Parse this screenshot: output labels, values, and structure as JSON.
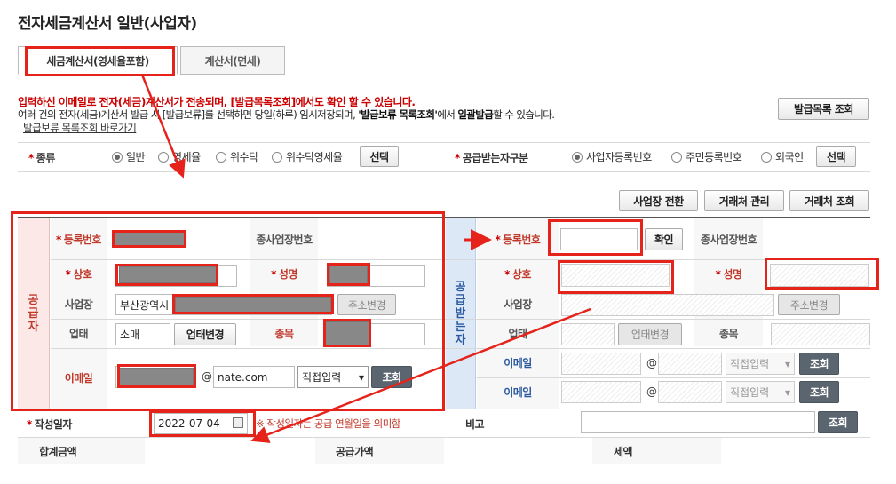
{
  "page": {
    "title": "전자세금계산서 일반(사업자)"
  },
  "tabs": [
    {
      "label": "세금계산서(영세율포함)",
      "active": true
    },
    {
      "label": "계산서(면세)",
      "active": false
    }
  ],
  "notice": {
    "red_line": "입력하신 이메일로 전자(세금)계산서가 전송되며, [발급목록조회]에서도 확인 할 수 있습니다.",
    "line2_a": "여러 건의 전자(세금)계산서 발급 시 [발급보류]를 선택하면 당일(하루) 임시저장되며, ",
    "line2_b": "'발급보류 목록조회'",
    "line2_c": "에서 ",
    "line2_d": "일괄발급",
    "line2_e": "할 수 있습니다.",
    "link": "발급보류 목록조회 바로가기"
  },
  "buttons": {
    "issue_list": "발급목록 조회",
    "select": "선택",
    "switch_business": "사업장 전환",
    "manage_partner": "거래처 관리",
    "search_partner": "거래처 조회",
    "confirm": "확인",
    "change_address": "주소변경",
    "change_business_type": "업태변경",
    "lookup": "조회"
  },
  "kind": {
    "label": "종류",
    "options": [
      "일반",
      "영세율",
      "위수탁",
      "위수탁영세율"
    ],
    "selected": "일반"
  },
  "receiver_type": {
    "label": "공급받는자구분",
    "options": [
      "사업자등록번호",
      "주민등록번호",
      "외국인"
    ],
    "selected": "사업자등록번호"
  },
  "supplier": {
    "side_label": "공급자",
    "reg_no_label": "등록번호",
    "sub_biz_label": "종사업장번호",
    "company_label": "상호",
    "name_label": "성명",
    "address_label": "사업장",
    "address_value": "부산광역시",
    "biz_type_label": "업태",
    "biz_type_value": "소매",
    "biz_item_label": "종목",
    "email_label": "이메일",
    "email_at": "@",
    "email_domain": "nate.com",
    "email_select": "직접입력"
  },
  "receiver": {
    "side_label": "공급받는자",
    "reg_no_label": "등록번호",
    "sub_biz_label": "종사업장번호",
    "company_label": "상호",
    "name_label": "성명",
    "address_label": "사업장",
    "biz_type_label": "업태",
    "biz_item_label": "종목",
    "email_label": "이메일",
    "email_at": "@",
    "email_select": "직접입력"
  },
  "footer": {
    "date_label": "작성일자",
    "date_value": "2022-07-04",
    "date_note": "※ 작성일자는 공급 연월일을 의미함",
    "remarks_label": "비고",
    "total_label": "합계금액",
    "supply_label": "공급가액",
    "tax_label": "세액"
  },
  "colors": {
    "highlight": "#e5231b",
    "supplier": "#c0392b",
    "receiver": "#2c5aa0"
  }
}
